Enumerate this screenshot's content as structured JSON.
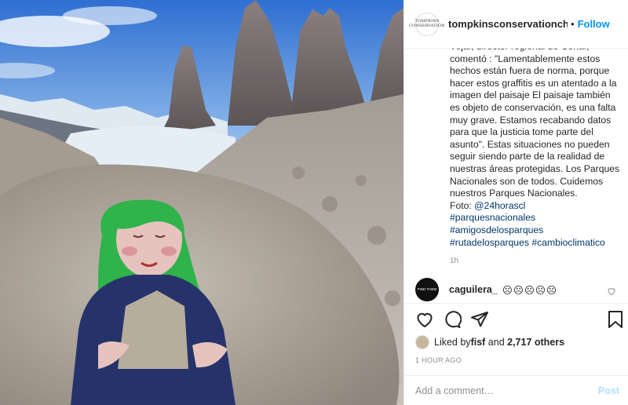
{
  "post": {
    "avatar_text": "TOMPKINS CONSERVATION",
    "username": "tompkinsconservationchile",
    "separator": "•",
    "follow_label": "Follow",
    "caption_lines": [
      "Vejar, director regional de Conaf,",
      "comentó : \"Lamentablemente estos",
      "hechos están fuera de norma, porque",
      "hacer estos graffitis es un atentado a la",
      "imagen del paisaje  El paisaje también",
      "es objeto de conservación, es una falta",
      "muy grave. Estamos recabando datos",
      "para que la justicia tome parte del",
      "asunto\". Estas situaciones no pueden",
      "seguir siendo parte de la realidad de",
      "nuestras áreas protegidas. Los Parques",
      "Nacionales son de todos. Cuidemos",
      "nuestros Parques Nacionales."
    ],
    "photo_credit_prefix": "Foto: ",
    "photo_credit_handle": "@24horascl",
    "hashtags_line1": "#parquesnacionales",
    "hashtags_line2": "#amigosdelosparques",
    "hashtags_line3a": "#rutadelosparques",
    "hashtags_line3b": "#cambioclimatico",
    "caption_time": "1h"
  },
  "comment": {
    "avatar_text": "FIND THEM",
    "username": "caguilera_",
    "text": "☹☹☹☹☹"
  },
  "likes": {
    "prefix": "Liked by ",
    "user": "fisf",
    "middle": " and ",
    "count": "2,717 others"
  },
  "posted_ago": "1 HOUR AGO",
  "add_comment": {
    "placeholder": "Add a comment…",
    "post_label": "Post"
  },
  "icons": {
    "heart": "heart-icon",
    "comment": "comment-icon",
    "share": "share-icon",
    "save": "bookmark-icon"
  },
  "colors": {
    "link": "#0095f6",
    "hashtag": "#00376b",
    "muted": "#8e8e8e",
    "post_disabled": "#b2dffc"
  }
}
